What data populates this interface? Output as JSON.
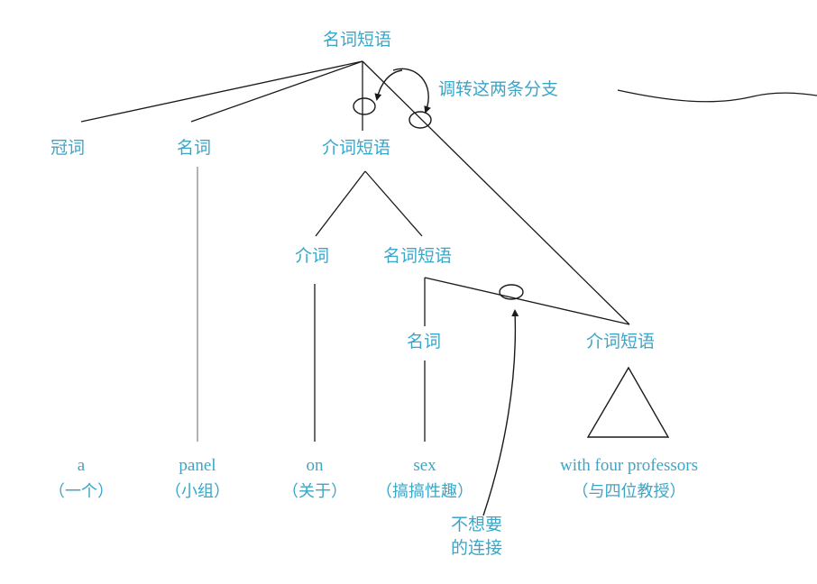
{
  "tree": {
    "root": "名词短语",
    "nodes": {
      "article": "冠词",
      "noun_1": "名词",
      "pp_1": "介词短语",
      "prep": "介词",
      "np_2": "名词短语",
      "noun_2": "名词",
      "pp_2": "介词短语"
    },
    "leaves": [
      {
        "word": "a",
        "gloss": "（一个）"
      },
      {
        "word": "panel",
        "gloss": "（小组）"
      },
      {
        "word": "on",
        "gloss": "（关于）"
      },
      {
        "word": "sex",
        "gloss": "（搞搞性趣）"
      },
      {
        "word": "with four professors",
        "gloss": "（与四位教授）"
      }
    ]
  },
  "annotations": {
    "swap_branches": "调转这两条分支",
    "unwanted_line1": "不想要",
    "unwanted_line2": "的连接"
  },
  "colors": {
    "text": "#3aa6c8",
    "lines": "#1a1a1a",
    "leaf_lines": "#9a9a9a"
  }
}
